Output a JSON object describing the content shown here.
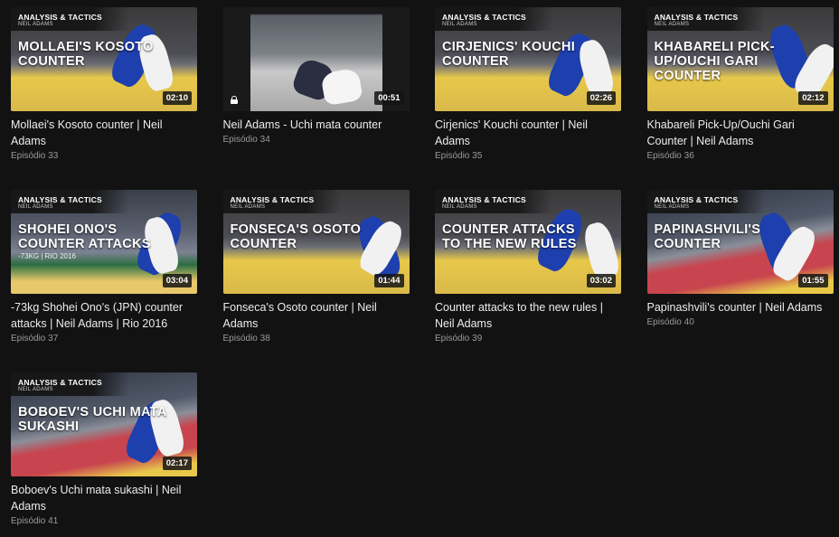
{
  "videos": [
    {
      "thumb_tag": "ANALYSIS & TACTICS",
      "thumb_author": "NEIL ADAMS",
      "thumb_title": "MOLLAEI'S KOSOTO COUNTER",
      "thumb_sub": "",
      "duration": "02:10",
      "title": "Mollaei's Kosoto counter | Neil Adams",
      "episode": "Episódio 33",
      "locked": false,
      "scheme": "yellow"
    },
    {
      "thumb_tag": "",
      "thumb_author": "",
      "thumb_title": "",
      "thumb_sub": "",
      "duration": "00:51",
      "title": "Neil Adams - Uchi mata counter",
      "episode": "Episódio 34",
      "locked": true,
      "scheme": "gray"
    },
    {
      "thumb_tag": "ANALYSIS & TACTICS",
      "thumb_author": "NEIL ADAMS",
      "thumb_title": "CIRJENICS' KOUCHI COUNTER",
      "thumb_sub": "",
      "duration": "02:26",
      "title": "Cirjenics' Kouchi counter | Neil Adams",
      "episode": "Episódio 35",
      "locked": false,
      "scheme": "yellow"
    },
    {
      "thumb_tag": "ANALYSIS & TACTICS",
      "thumb_author": "NEIL ADAMS",
      "thumb_title": "KHABARELI PICK-UP/OUCHI GARI COUNTER",
      "thumb_sub": "",
      "duration": "02:12",
      "title": "Khabareli Pick-Up/Ouchi Gari Counter | Neil Adams",
      "episode": "Episódio 36",
      "locked": false,
      "scheme": "yellow"
    },
    {
      "thumb_tag": "ANALYSIS & TACTICS",
      "thumb_author": "NEIL ADAMS",
      "thumb_title": "SHOHEI ONO'S COUNTER ATTACKS",
      "thumb_sub": "-73KG | RIO 2016",
      "duration": "03:04",
      "title": "-73kg Shohei Ono's (JPN) counter attacks | Neil Adams | Rio 2016",
      "episode": "Episódio 37",
      "locked": false,
      "scheme": "blue"
    },
    {
      "thumb_tag": "ANALYSIS & TACTICS",
      "thumb_author": "NEIL ADAMS",
      "thumb_title": "FONSECA'S OSOTO COUNTER",
      "thumb_sub": "",
      "duration": "01:44",
      "title": "Fonseca's Osoto counter | Neil Adams",
      "episode": "Episódio 38",
      "locked": false,
      "scheme": "yellow"
    },
    {
      "thumb_tag": "ANALYSIS & TACTICS",
      "thumb_author": "NEIL ADAMS",
      "thumb_title": "COUNTER ATTACKS TO THE NEW RULES",
      "thumb_sub": "",
      "duration": "03:02",
      "title": "Counter attacks to the new rules | Neil Adams",
      "episode": "Episódio 39",
      "locked": false,
      "scheme": "yellow"
    },
    {
      "thumb_tag": "ANALYSIS & TACTICS",
      "thumb_author": "NEIL ADAMS",
      "thumb_title": "PAPINASHVILI'S COUNTER",
      "thumb_sub": "",
      "duration": "01:55",
      "title": "Papinashvili's counter | Neil Adams",
      "episode": "Episódio 40",
      "locked": false,
      "scheme": "red"
    },
    {
      "thumb_tag": "ANALYSIS & TACTICS",
      "thumb_author": "NEIL ADAMS",
      "thumb_title": "BOBOEV'S UCHI MATA SUKASHI",
      "thumb_sub": "",
      "duration": "02:17",
      "title": "Boboev's Uchi mata sukashi | Neil Adams",
      "episode": "Episódio 41",
      "locked": false,
      "scheme": "red"
    }
  ],
  "colors": {
    "background": "#121212",
    "judogi_blue": "#1e3fae",
    "mat_yellow": "#e8c84a",
    "mat_red": "#c8454f"
  }
}
